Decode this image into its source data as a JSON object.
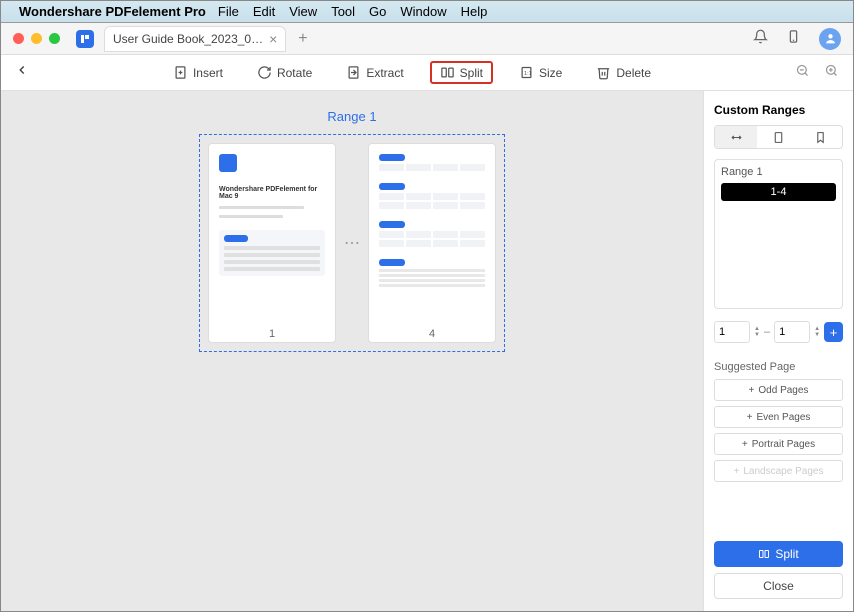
{
  "menubar": {
    "app_name": "Wondershare PDFelement Pro",
    "items": [
      "File",
      "Edit",
      "View",
      "Tool",
      "Go",
      "Window",
      "Help"
    ]
  },
  "tabbar": {
    "tab_title": "User Guide Book_2023_0…"
  },
  "toolbar": {
    "insert": "Insert",
    "rotate": "Rotate",
    "extract": "Extract",
    "split": "Split",
    "size": "Size",
    "delete": "Delete"
  },
  "canvas": {
    "range_label": "Range 1",
    "thumb1_title": "Wondershare PDFelement for Mac 9",
    "page1_num": "1",
    "page2_num": "4"
  },
  "panel": {
    "title": "Custom Ranges",
    "range_name": "Range 1",
    "range_value": "1-4",
    "from_value": "1",
    "to_value": "1",
    "suggested_label": "Suggested Page",
    "odd": "Odd Pages",
    "even": "Even Pages",
    "portrait": "Portrait Pages",
    "landscape": "Landscape Pages",
    "split_btn": "Split",
    "close_btn": "Close"
  }
}
